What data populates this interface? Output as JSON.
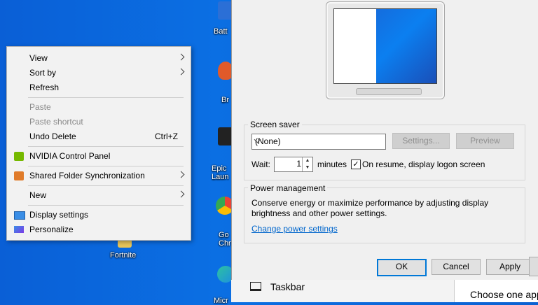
{
  "desktop": {
    "icons": [
      {
        "label": "Batt",
        "color": "#2b6fd6"
      },
      {
        "label": "Br",
        "color": "#e05a2a"
      },
      {
        "label": "Epic\nLaun",
        "color": "#222222"
      },
      {
        "label": "Go\nChr",
        "color": "#34a853"
      },
      {
        "label": "Micr",
        "color": "#1d8fe0"
      }
    ],
    "fortnite_label": "Fortnite"
  },
  "context_menu": {
    "view": "View",
    "sort_by": "Sort by",
    "refresh": "Refresh",
    "paste": "Paste",
    "paste_shortcut": "Paste shortcut",
    "undo_delete": "Undo Delete",
    "undo_shortcut": "Ctrl+Z",
    "nvidia": "NVIDIA Control Panel",
    "shared_folder": "Shared Folder Synchronization",
    "new": "New",
    "display_settings": "Display settings",
    "personalize": "Personalize"
  },
  "dialog": {
    "screen_saver_group": "Screen saver",
    "screen_saver_value": "(None)",
    "settings_button": "Settings...",
    "preview_button": "Preview",
    "wait_label": "Wait:",
    "wait_value": "1",
    "minutes_label": "minutes",
    "resume_label": "On resume, display logon screen",
    "resume_checked": true,
    "power_group": "Power management",
    "power_text": "Conserve energy or maximize performance by adjusting display brightness and other power settings.",
    "power_link": "Change power settings",
    "ok": "OK",
    "cancel": "Cancel",
    "apply": "Apply"
  },
  "settings_window": {
    "taskbar_label": "Taskbar",
    "side_text": "Choose one app"
  },
  "colors": {
    "desktop_blue": "#0b6fe3",
    "link": "#0066cc",
    "accent": "#0078d7"
  }
}
